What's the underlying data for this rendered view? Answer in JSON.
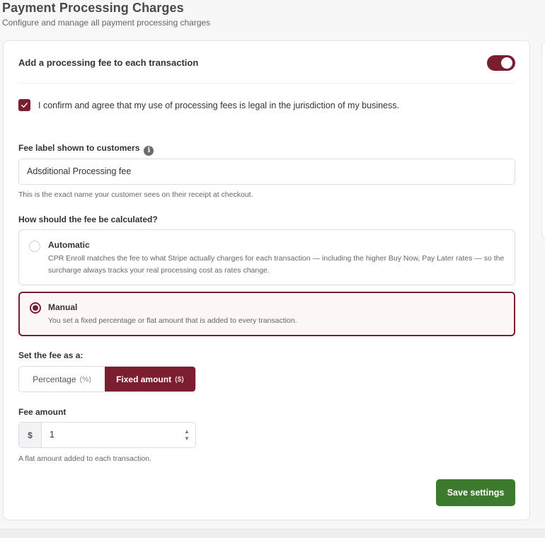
{
  "header": {
    "title": "Payment Processing Charges",
    "subtitle": "Configure and manage all payment processing charges"
  },
  "fee_toggle": {
    "label": "Add a processing fee to each transaction",
    "enabled": true
  },
  "confirm": {
    "text": "I confirm and agree that my use of processing fees is legal in the jurisdiction of my business.",
    "checked": true
  },
  "fee_label": {
    "label": "Fee label shown to customers",
    "value": "Adsditional Processing fee",
    "help": "This is the exact name your customer sees on their receipt at checkout."
  },
  "calculation": {
    "question": "How should the fee be calculated?",
    "options": [
      {
        "title": "Automatic",
        "description": "CPR Enroll matches the fee to what Stripe actually charges for each transaction — including the higher Buy Now, Pay Later rates — so the surcharge always tracks your real processing cost as rates change.",
        "selected": false
      },
      {
        "title": "Manual",
        "description": "You set a fixed percentage or flat amount that is added to every transaction.",
        "selected": true
      }
    ]
  },
  "fee_type": {
    "label": "Set the fee as a:",
    "percentage_label": "Percentage",
    "percentage_unit": "(%)",
    "fixed_label": "Fixed amount",
    "fixed_unit": "($)",
    "selected": "fixed"
  },
  "fee_amount": {
    "label": "Fee amount",
    "currency": "$",
    "value": "1",
    "help": "A flat amount added to each transaction."
  },
  "actions": {
    "save_label": "Save settings"
  },
  "colors": {
    "accent": "#7b1e30",
    "save": "#3d7a2e"
  }
}
